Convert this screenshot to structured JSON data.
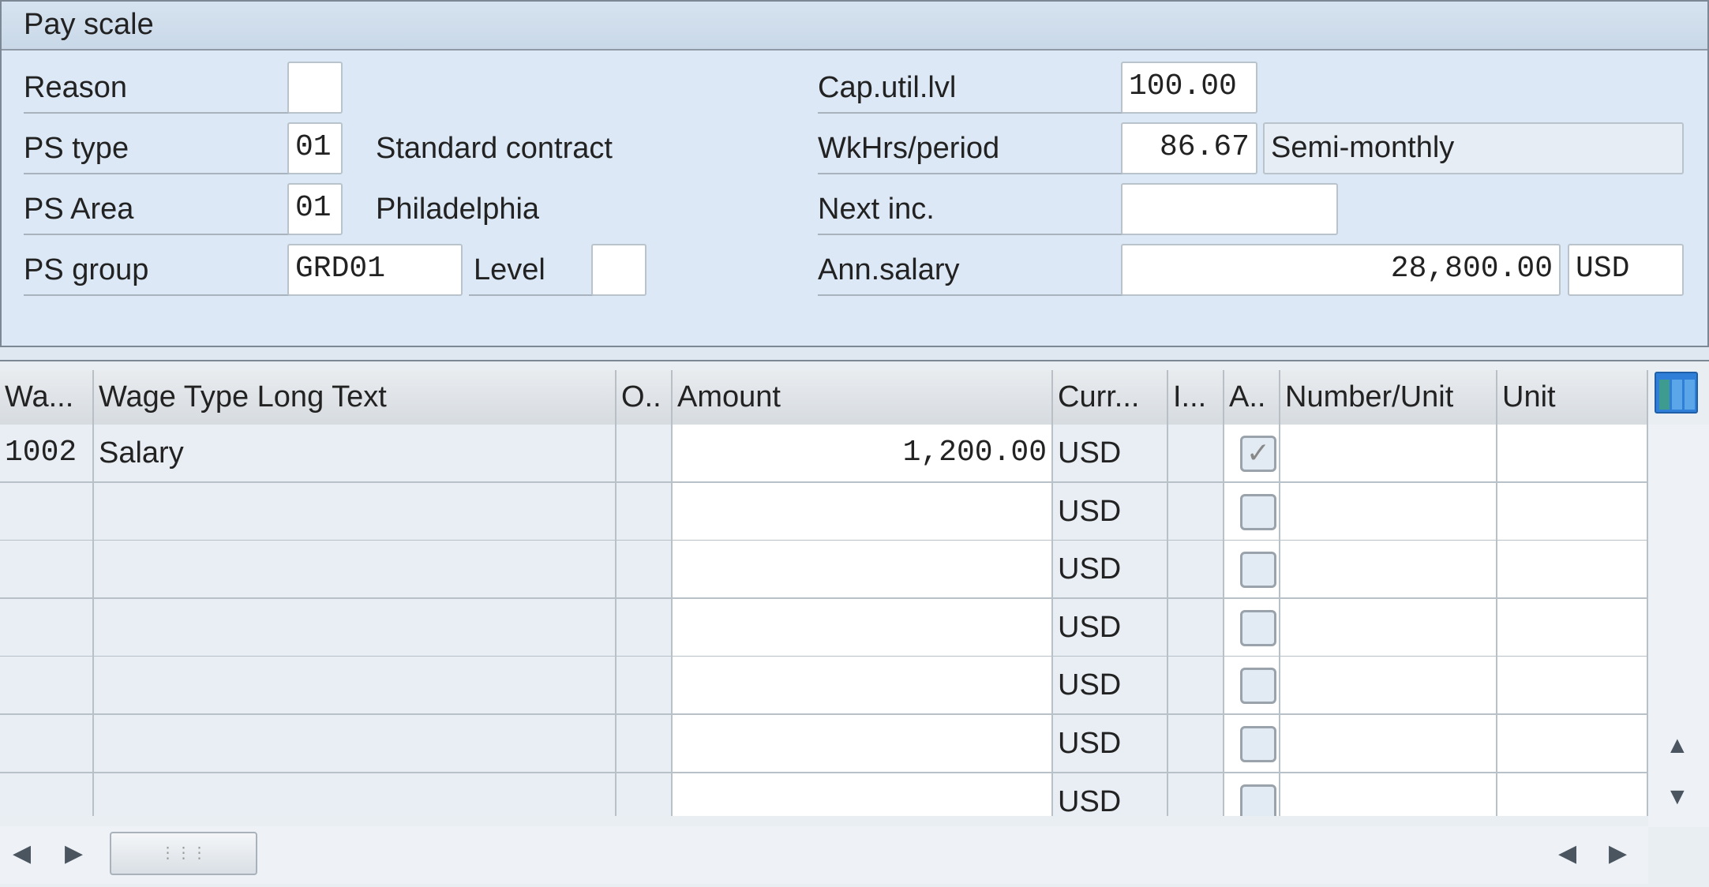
{
  "group_title": "Pay scale",
  "left_fields": [
    {
      "label": "Reason",
      "value": ""
    },
    {
      "label": "PS type",
      "value": "01",
      "text": "Standard contract"
    },
    {
      "label": "PS Area",
      "value": "01",
      "text": "Philadelphia"
    },
    {
      "label": "PS group",
      "value": "GRD01",
      "level_label": "Level",
      "level_value": ""
    }
  ],
  "right_fields": [
    {
      "label": "Cap.util.lvl",
      "value": "100.00"
    },
    {
      "label": "WkHrs/period",
      "value": "86.67",
      "text": "Semi-monthly"
    },
    {
      "label": "Next inc.",
      "value": ""
    },
    {
      "label": "Ann.salary",
      "value": "28,800.00",
      "currency": "USD"
    }
  ],
  "table": {
    "columns": [
      "Wa...",
      "Wage Type Long Text",
      "O..",
      "Amount",
      "Curr...",
      "I...",
      "A..",
      "Number/Unit",
      "Unit"
    ],
    "rows": [
      {
        "wage_type": "1002",
        "long_text": "Salary",
        "o": "",
        "amount": "1,200.00",
        "currency": "USD",
        "i": "",
        "a": true,
        "number": "",
        "unit": ""
      },
      {
        "wage_type": "",
        "long_text": "",
        "o": "",
        "amount": "",
        "currency": "USD",
        "i": "",
        "a": false,
        "number": "",
        "unit": ""
      },
      {
        "wage_type": "",
        "long_text": "",
        "o": "",
        "amount": "",
        "currency": "USD",
        "i": "",
        "a": false,
        "number": "",
        "unit": ""
      },
      {
        "wage_type": "",
        "long_text": "",
        "o": "",
        "amount": "",
        "currency": "USD",
        "i": "",
        "a": false,
        "number": "",
        "unit": ""
      },
      {
        "wage_type": "",
        "long_text": "",
        "o": "",
        "amount": "",
        "currency": "USD",
        "i": "",
        "a": false,
        "number": "",
        "unit": ""
      },
      {
        "wage_type": "",
        "long_text": "",
        "o": "",
        "amount": "",
        "currency": "USD",
        "i": "",
        "a": false,
        "number": "",
        "unit": ""
      },
      {
        "wage_type": "",
        "long_text": "",
        "o": "",
        "amount": "",
        "currency": "USD",
        "i": "",
        "a": false,
        "number": "",
        "unit": ""
      }
    ]
  },
  "icons": {
    "column_config": "table-columns-icon",
    "scroll_up": "triangle-up-icon",
    "scroll_down": "triangle-down-icon",
    "scroll_left": "triangle-left-icon",
    "scroll_right": "triangle-right-icon"
  },
  "colors": {
    "panel_bg": "#dce8f5",
    "config_icon": "#2f7fd8"
  }
}
